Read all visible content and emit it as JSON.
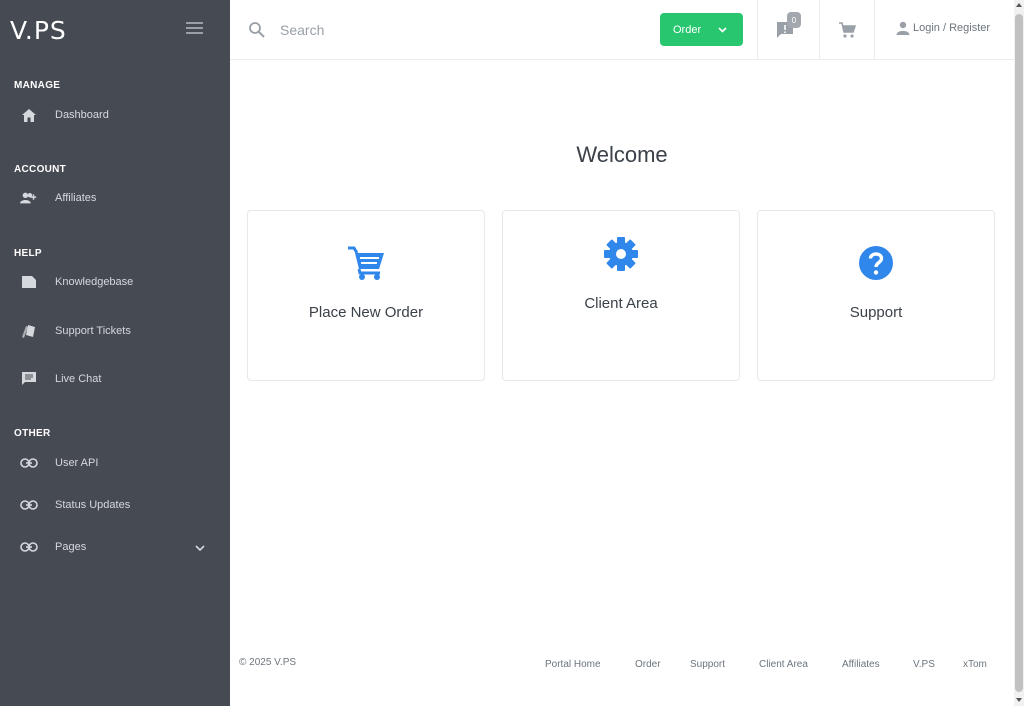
{
  "brand": "V.PS",
  "sidebar": {
    "sections": [
      {
        "title": "MANAGE",
        "items": [
          {
            "label": "Dashboard",
            "icon": "home-icon"
          }
        ]
      },
      {
        "title": "ACCOUNT",
        "items": [
          {
            "label": "Affiliates",
            "icon": "affiliates-icon"
          }
        ]
      },
      {
        "title": "HELP",
        "items": [
          {
            "label": "Knowledgebase",
            "icon": "book-icon"
          },
          {
            "label": "Support Tickets",
            "icon": "tickets-icon"
          },
          {
            "label": "Live Chat",
            "icon": "chat-icon"
          }
        ]
      },
      {
        "title": "OTHER",
        "items": [
          {
            "label": "User API",
            "icon": "link-icon"
          },
          {
            "label": "Status Updates",
            "icon": "link-icon"
          },
          {
            "label": "Pages",
            "icon": "link-icon"
          }
        ]
      }
    ]
  },
  "topbar": {
    "search_placeholder": "Search",
    "order_label": "Order",
    "notifications_count": "0",
    "login_label": "Login / Register"
  },
  "main": {
    "welcome": "Welcome",
    "cards": [
      {
        "title": "Place New Order",
        "icon": "cart-icon"
      },
      {
        "title": "Client Area",
        "icon": "gear-icon"
      },
      {
        "title": "Support",
        "icon": "question-icon"
      }
    ]
  },
  "footer": {
    "copyright": "© 2025 V.PS",
    "links": [
      "Portal Home",
      "Order",
      "Support",
      "Client Area",
      "Affiliates",
      "V.PS",
      "xTom"
    ]
  },
  "colors": {
    "sidebar_bg": "#464a53",
    "accent_green": "#28c76f",
    "icon_blue": "#2f86eb"
  }
}
